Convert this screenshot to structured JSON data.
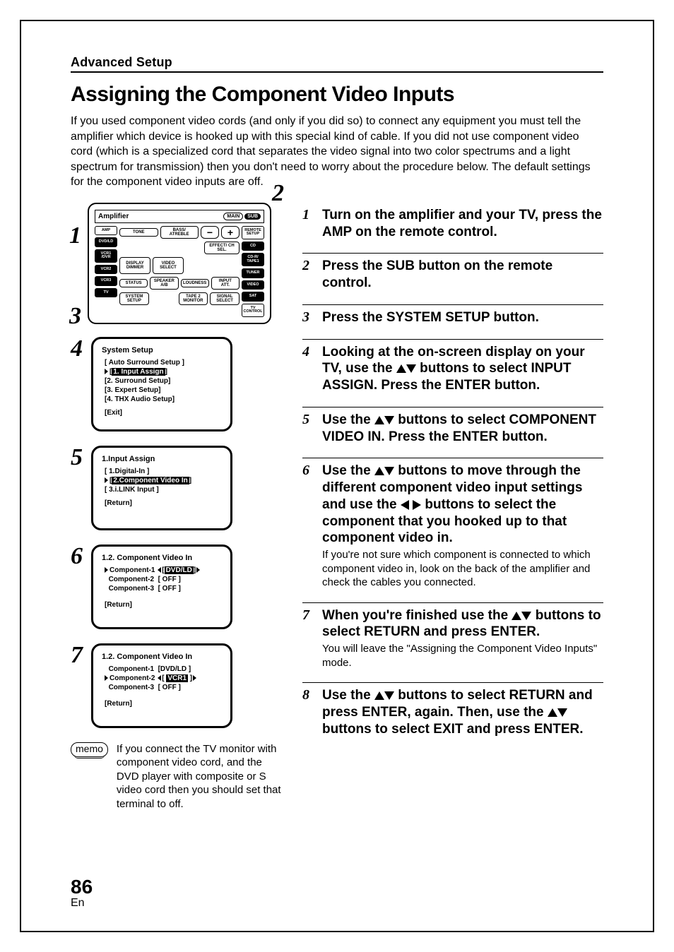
{
  "section_head": "Advanced Setup",
  "title": "Assigning the Component Video Inputs",
  "intro": "If you used component video cords (and only if you did so) to connect any equipment you must tell the amplifier which device is hooked up with this special kind of cable. If you did not use component video cord (which is a specialized cord that separates the video signal into two color spectrums and a light spectrum for transmission) then you don't need to worry about the procedure below. The default settings for the component video inputs are off.",
  "remote": {
    "title": "Amplifier",
    "main": "MAIN",
    "sub": "SUB",
    "side_left": [
      "AMP",
      "DVD/LD",
      "VCR1\n/DVR",
      "VCR2",
      "VCR3",
      "TV"
    ],
    "side_right": [
      "REMOTE\nSETUP",
      "CD",
      "CD-R/\nTAPE1",
      "TUNER",
      "VIDEO",
      "SAT",
      "TV\nCONTROL"
    ],
    "mid_rows": [
      [
        "TONE",
        "BASS/\nATREBLE",
        "−",
        "+"
      ],
      [
        "",
        "",
        "EFFECT/\nCH SEL."
      ],
      [
        "DISPLAY\nDIMMER",
        "VIDEO\nSELECT"
      ],
      [
        "STATUS",
        "SPEAKER\nA/B",
        "LOUDNESS",
        "INPUT\nATT."
      ],
      [
        "SYSTEM\nSETUP",
        "",
        "TAPE 2\nMONITOR",
        "SIGNAL\nSELECT"
      ]
    ],
    "callouts": {
      "n1": "1",
      "n2": "2",
      "n3": "3"
    }
  },
  "osd4": {
    "num": "4",
    "title": "System Setup",
    "lines": [
      "[ Auto Surround Setup ]",
      "1. Input Assign",
      "[2. Surround Setup]",
      "[3. Expert Setup]",
      "[4. THX Audio Setup]",
      "[Exit]"
    ]
  },
  "osd5": {
    "num": "5",
    "title": "1.Input Assign",
    "lines": [
      "[ 1.Digital-In ]",
      "2.Component Video In",
      "[ 3.i.LINK Input ]",
      "[Return]"
    ]
  },
  "osd6": {
    "num": "6",
    "title": "1.2. Component  Video  In",
    "l1a": "Component-1",
    "l1b": "DVD/LD",
    "l2a": "Component-2",
    "l2b": "[   OFF    ]",
    "l3a": "Component-3",
    "l3b": "[   OFF    ]",
    "ret": "[Return]"
  },
  "osd7": {
    "num": "7",
    "title": "1.2. Component  Video  In",
    "l1a": "Component-1",
    "l1b": "[DVD/LD ]",
    "l2a": "Component-2",
    "l2b": "VCR1",
    "l3a": "Component-3",
    "l3b": "[   OFF    ]",
    "ret": "[Return]"
  },
  "memo_label": "memo",
  "memo_text": "If you connect the TV monitor with component video cord, and the DVD player with composite or S video cord then you should set that terminal to off.",
  "steps": {
    "s1": {
      "n": "1",
      "t": "Turn on the amplifier and your TV, press the AMP on the remote control."
    },
    "s2": {
      "n": "2",
      "t": "Press the SUB button on the remote control."
    },
    "s3": {
      "n": "3",
      "t": "Press the SYSTEM SETUP button."
    },
    "s4": {
      "n": "4",
      "t_a": "Looking at the on-screen display on your TV, use the ",
      "t_b": " buttons to select INPUT ASSIGN.  Press the ENTER button."
    },
    "s5": {
      "n": "5",
      "t_a": "Use the ",
      "t_b": " buttons to select COMPONENT VIDEO IN. Press the ENTER button."
    },
    "s6": {
      "n": "6",
      "t_a": "Use the ",
      "t_b": " buttons to move through the different component video input settings and use the ",
      "t_c": " buttons to select the component that you hooked up to that component video in.",
      "sub": "If you're not sure which component is connected to which component video in, look on the back of the amplifier and check the cables you connected."
    },
    "s7": {
      "n": "7",
      "t_a": "When you're finished use the ",
      "t_b": " buttons to select RETURN and press ENTER.",
      "sub": "You will leave the \"Assigning the Component Video Inputs\" mode."
    },
    "s8": {
      "n": "8",
      "t_a": "Use the ",
      "t_b": " buttons to select RETURN and press ENTER, again. Then, use the ",
      "t_c": " buttons to select EXIT and press ENTER."
    }
  },
  "page_num": "86",
  "page_lang": "En"
}
